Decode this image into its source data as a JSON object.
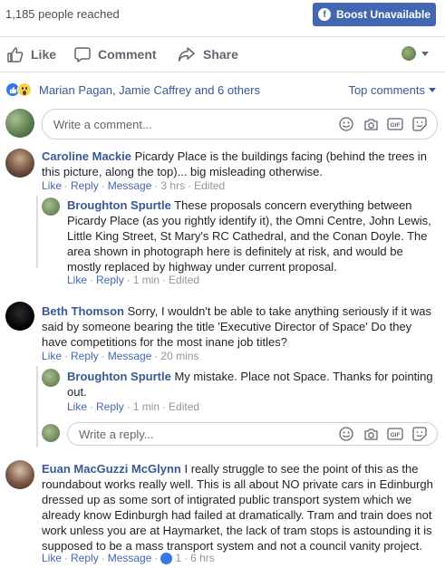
{
  "header": {
    "reach_text": "1,185 people reached",
    "boost_label": "Boost Unavailable",
    "boost_icon": "facebook-f-icon"
  },
  "actions": {
    "like": "Like",
    "comment": "Comment",
    "share": "Share"
  },
  "reactions": {
    "names": "Marian Pagan, Jamie Caffrey and 6 others",
    "sort_label": "Top comments",
    "icons": [
      "like-icon",
      "wow-icon"
    ]
  },
  "comment_input": {
    "placeholder": "Write a comment..."
  },
  "reply_input": {
    "placeholder": "Write a reply..."
  },
  "comments": [
    {
      "author": "Caroline Mackie",
      "text": "Picardy Place is the buildings facing (behind the trees in this picture, along the top)... big misleading otherwise.",
      "meta": {
        "like": "Like",
        "reply": "Reply",
        "message": "Message",
        "time": "3 hrs",
        "edited": "Edited"
      },
      "replies": [
        {
          "author": "Broughton Spurtle",
          "text": "These proposals concern everything between Picardy Place (as you rightly identify it), the Omni Centre, John Lewis, Little King Street, St Mary's RC Cathedral, and the Conan Doyle. The area shown in photograph here is definitely at risk, and would be mostly replaced by highway under current proposal.",
          "meta": {
            "like": "Like",
            "reply": "Reply",
            "time": "1 min",
            "edited": "Edited"
          }
        }
      ]
    },
    {
      "author": "Beth Thomson",
      "text": "Sorry, I wouldn't be able to take anything seriously if it was said by someone bearing the title 'Executive Director of Space' Do they have competitions for the most inane job titles?",
      "meta": {
        "like": "Like",
        "reply": "Reply",
        "message": "Message",
        "time": "20 mins"
      },
      "replies": [
        {
          "author": "Broughton Spurtle",
          "text": "My mistake. Place not Space. Thanks for pointing out.",
          "meta": {
            "like": "Like",
            "reply": "Reply",
            "time": "1 min",
            "edited": "Edited"
          }
        }
      ]
    },
    {
      "author": "Euan MacGuzzi McGlynn",
      "text": "I really struggle to see the point of this as the roundabout works really well. This is all about NO private cars in Edinburgh dressed up as some sort of intigrated public transport system which we already know Edinburgh had failed at dramatically. Tram and train does not work unless you are at Haymarket, the lack of tram stops is astounding it is supposed to be a mass transport system and not a council vanity project.",
      "meta": {
        "like": "Like",
        "reply": "Reply",
        "message": "Message",
        "likes": "1",
        "time": "6 hrs"
      }
    }
  ],
  "colors": {
    "brand": "#4267b2",
    "link": "#385898",
    "meta": "#90949c"
  }
}
